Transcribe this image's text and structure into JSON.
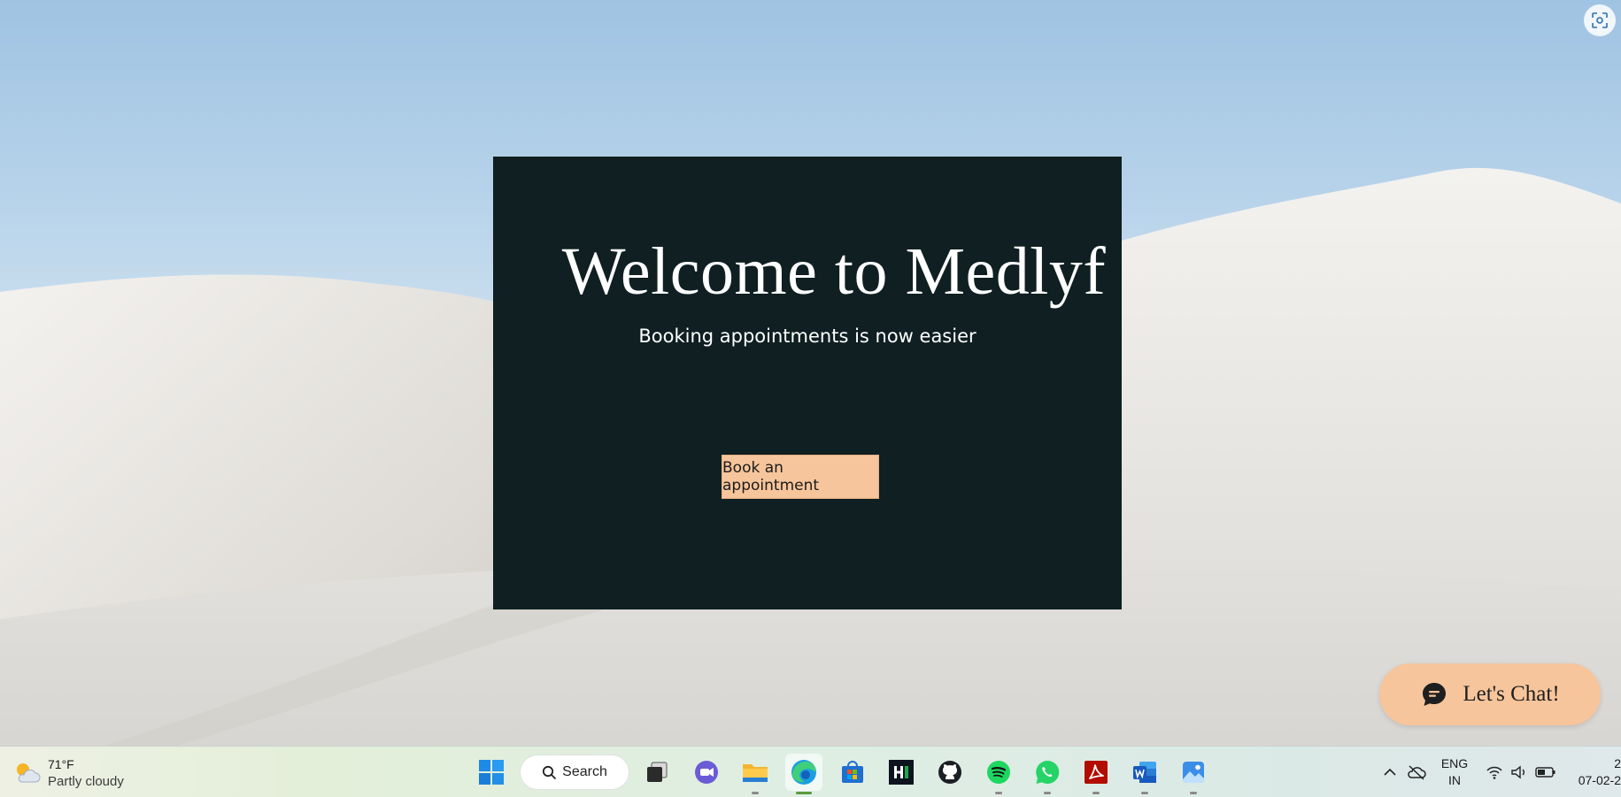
{
  "hero": {
    "title": "Welcome to Medlyf",
    "subtitle": "Booking appointments is now easier",
    "cta_label": "Book an appointment"
  },
  "chat": {
    "label": "Let's Chat!",
    "icon": "chat-bubble-icon"
  },
  "capture": {
    "icon": "screen-capture-icon"
  },
  "taskbar": {
    "weather": {
      "temp": "71°F",
      "desc": "Partly cloudy",
      "icon": "partly-cloudy-icon"
    },
    "search_label": "Search",
    "apps": [
      {
        "name": "start",
        "icon": "windows-start-icon"
      },
      {
        "name": "task-view",
        "icon": "task-view-icon"
      },
      {
        "name": "teams-chat",
        "icon": "video-chat-icon"
      },
      {
        "name": "file-explorer",
        "icon": "folder-icon"
      },
      {
        "name": "edge",
        "icon": "edge-browser-icon"
      },
      {
        "name": "store",
        "icon": "store-icon"
      },
      {
        "name": "hackerrank",
        "icon": "hackerrank-icon"
      },
      {
        "name": "github",
        "icon": "github-icon"
      },
      {
        "name": "spotify",
        "icon": "spotify-icon"
      },
      {
        "name": "whatsapp",
        "icon": "whatsapp-icon"
      },
      {
        "name": "acrobat",
        "icon": "acrobat-icon"
      },
      {
        "name": "word",
        "icon": "word-icon"
      },
      {
        "name": "photos",
        "icon": "photos-icon"
      }
    ],
    "tray": {
      "lang_line1": "ENG",
      "lang_line2": "IN",
      "time": "2",
      "date": "07-02-2"
    }
  },
  "colors": {
    "hero_bg": "#0f1f22",
    "cta_bg": "#f7c59b",
    "chat_bg": "#f7c59b"
  }
}
